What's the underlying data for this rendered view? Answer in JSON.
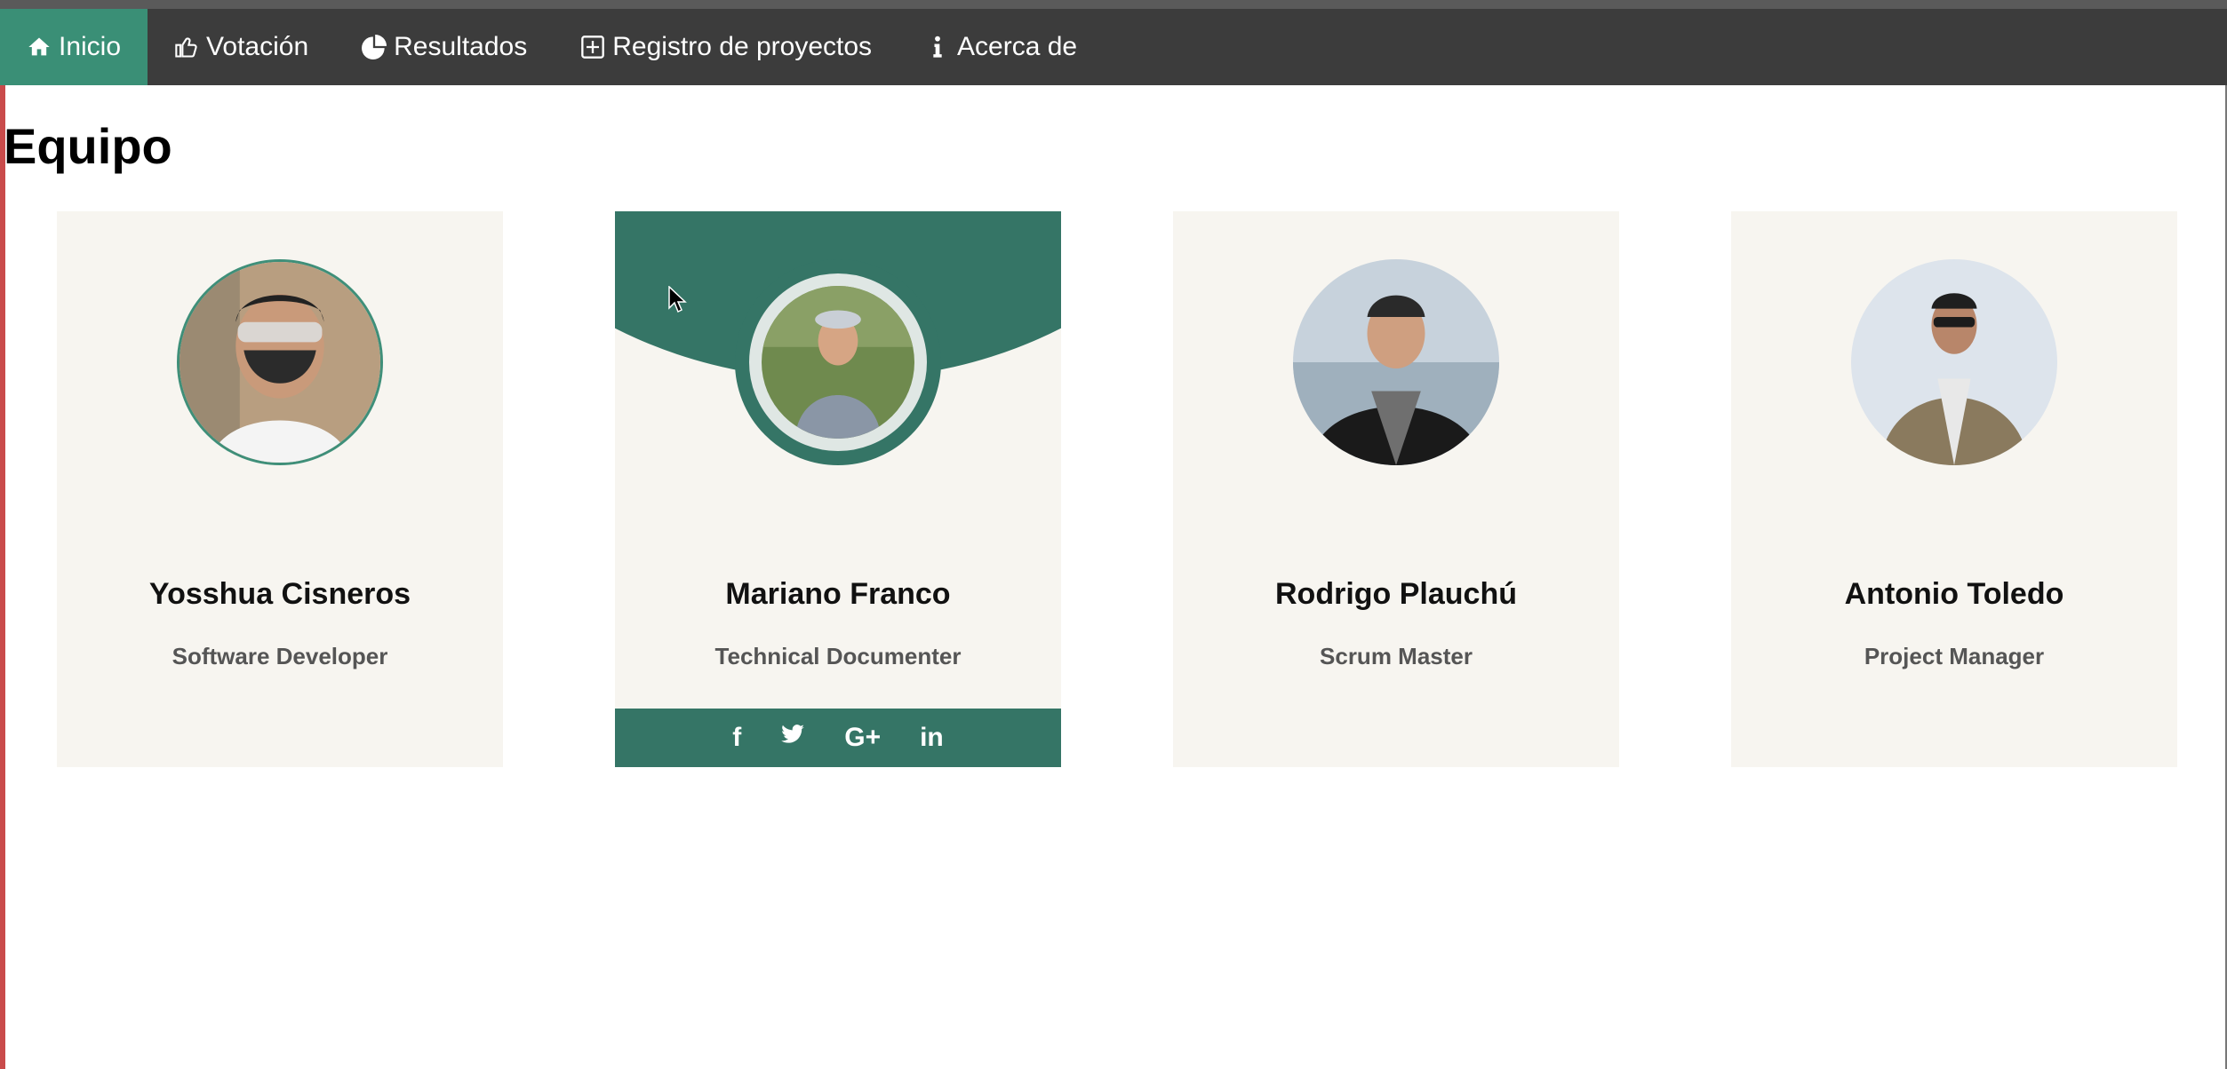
{
  "nav": {
    "items": [
      {
        "label": "Inicio",
        "icon": "home-icon",
        "active": true
      },
      {
        "label": "Votación",
        "icon": "thumbs-up-icon"
      },
      {
        "label": "Resultados",
        "icon": "pie-chart-icon"
      },
      {
        "label": "Registro de proyectos",
        "icon": "plus-square-icon"
      },
      {
        "label": "Acerca de",
        "icon": "info-icon"
      }
    ],
    "active_color": "#3a8f76",
    "bg_color": "#3c3c3c"
  },
  "page": {
    "title": "Equipo"
  },
  "team": [
    {
      "name": "Yosshua Cisneros",
      "role": "Software Developer"
    },
    {
      "name": "Mariano Franco",
      "role": "Technical Documenter"
    },
    {
      "name": "Rodrigo Plauchú",
      "role": "Scrum Master"
    },
    {
      "name": "Antonio Toledo",
      "role": "Project Manager"
    }
  ],
  "social": {
    "facebook": "f",
    "twitter": "twitter-icon",
    "googleplus": "G+",
    "linkedin": "in"
  },
  "colors": {
    "accent": "#357566",
    "card_bg": "#f7f5f0"
  }
}
